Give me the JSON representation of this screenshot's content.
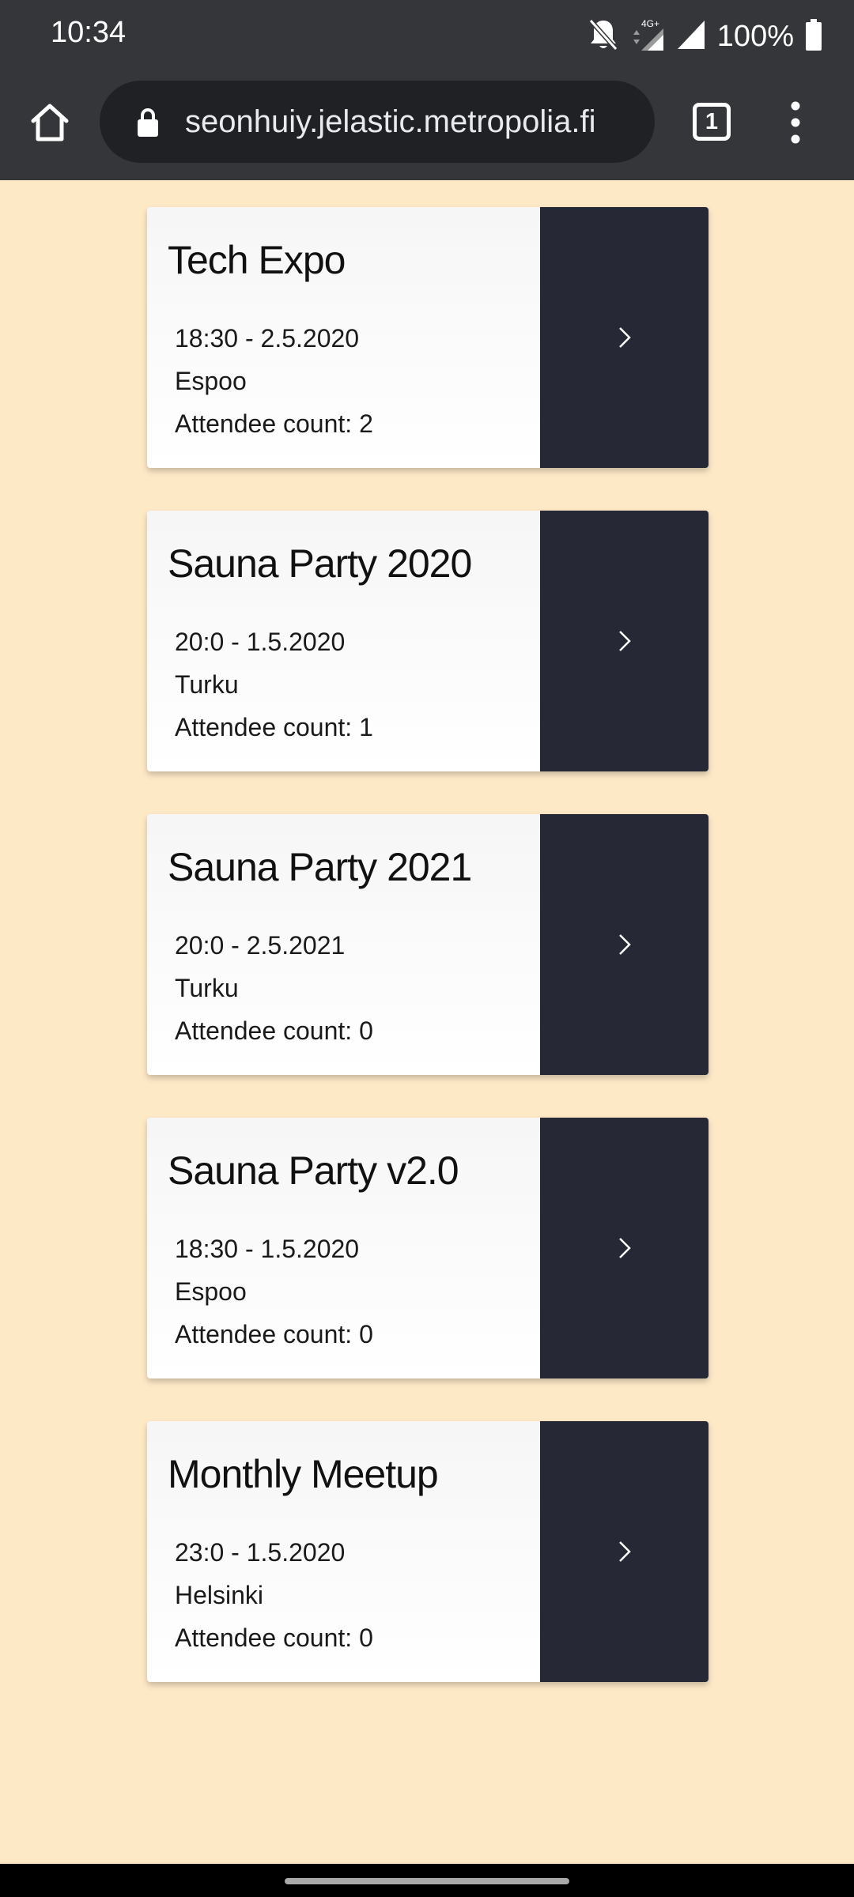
{
  "status_bar": {
    "time": "10:34",
    "network": "4G+",
    "battery": "100%",
    "icons": [
      "bell-off-icon",
      "signal-4g-icon",
      "signal-icon",
      "battery-icon"
    ]
  },
  "browser": {
    "url": "seonhuiy.jelastic.metropolia.fi",
    "tab_count": "1",
    "icons": [
      "home-icon",
      "lock-icon",
      "tabs-icon",
      "menu-dots-icon"
    ]
  },
  "events": [
    {
      "title": "Tech Expo",
      "time": "18:30 - 2.5.2020",
      "place": "Espoo",
      "attendees": "Attendee count: 2"
    },
    {
      "title": "Sauna Party 2020",
      "time": "20:0 - 1.5.2020",
      "place": "Turku",
      "attendees": "Attendee count: 1"
    },
    {
      "title": "Sauna Party 2021",
      "time": "20:0 - 2.5.2021",
      "place": "Turku",
      "attendees": "Attendee count: 0"
    },
    {
      "title": "Sauna Party v2.0",
      "time": "18:30 - 1.5.2020",
      "place": "Espoo",
      "attendees": "Attendee count: 0"
    },
    {
      "title": "Monthly Meetup",
      "time": "23:0 - 1.5.2020",
      "place": "Helsinki",
      "attendees": "Attendee count: 0"
    }
  ],
  "colors": {
    "page_background": "#fee9c7",
    "card_background": "#ffffff",
    "open_button": "#262835",
    "browser_chrome": "#35363a"
  }
}
